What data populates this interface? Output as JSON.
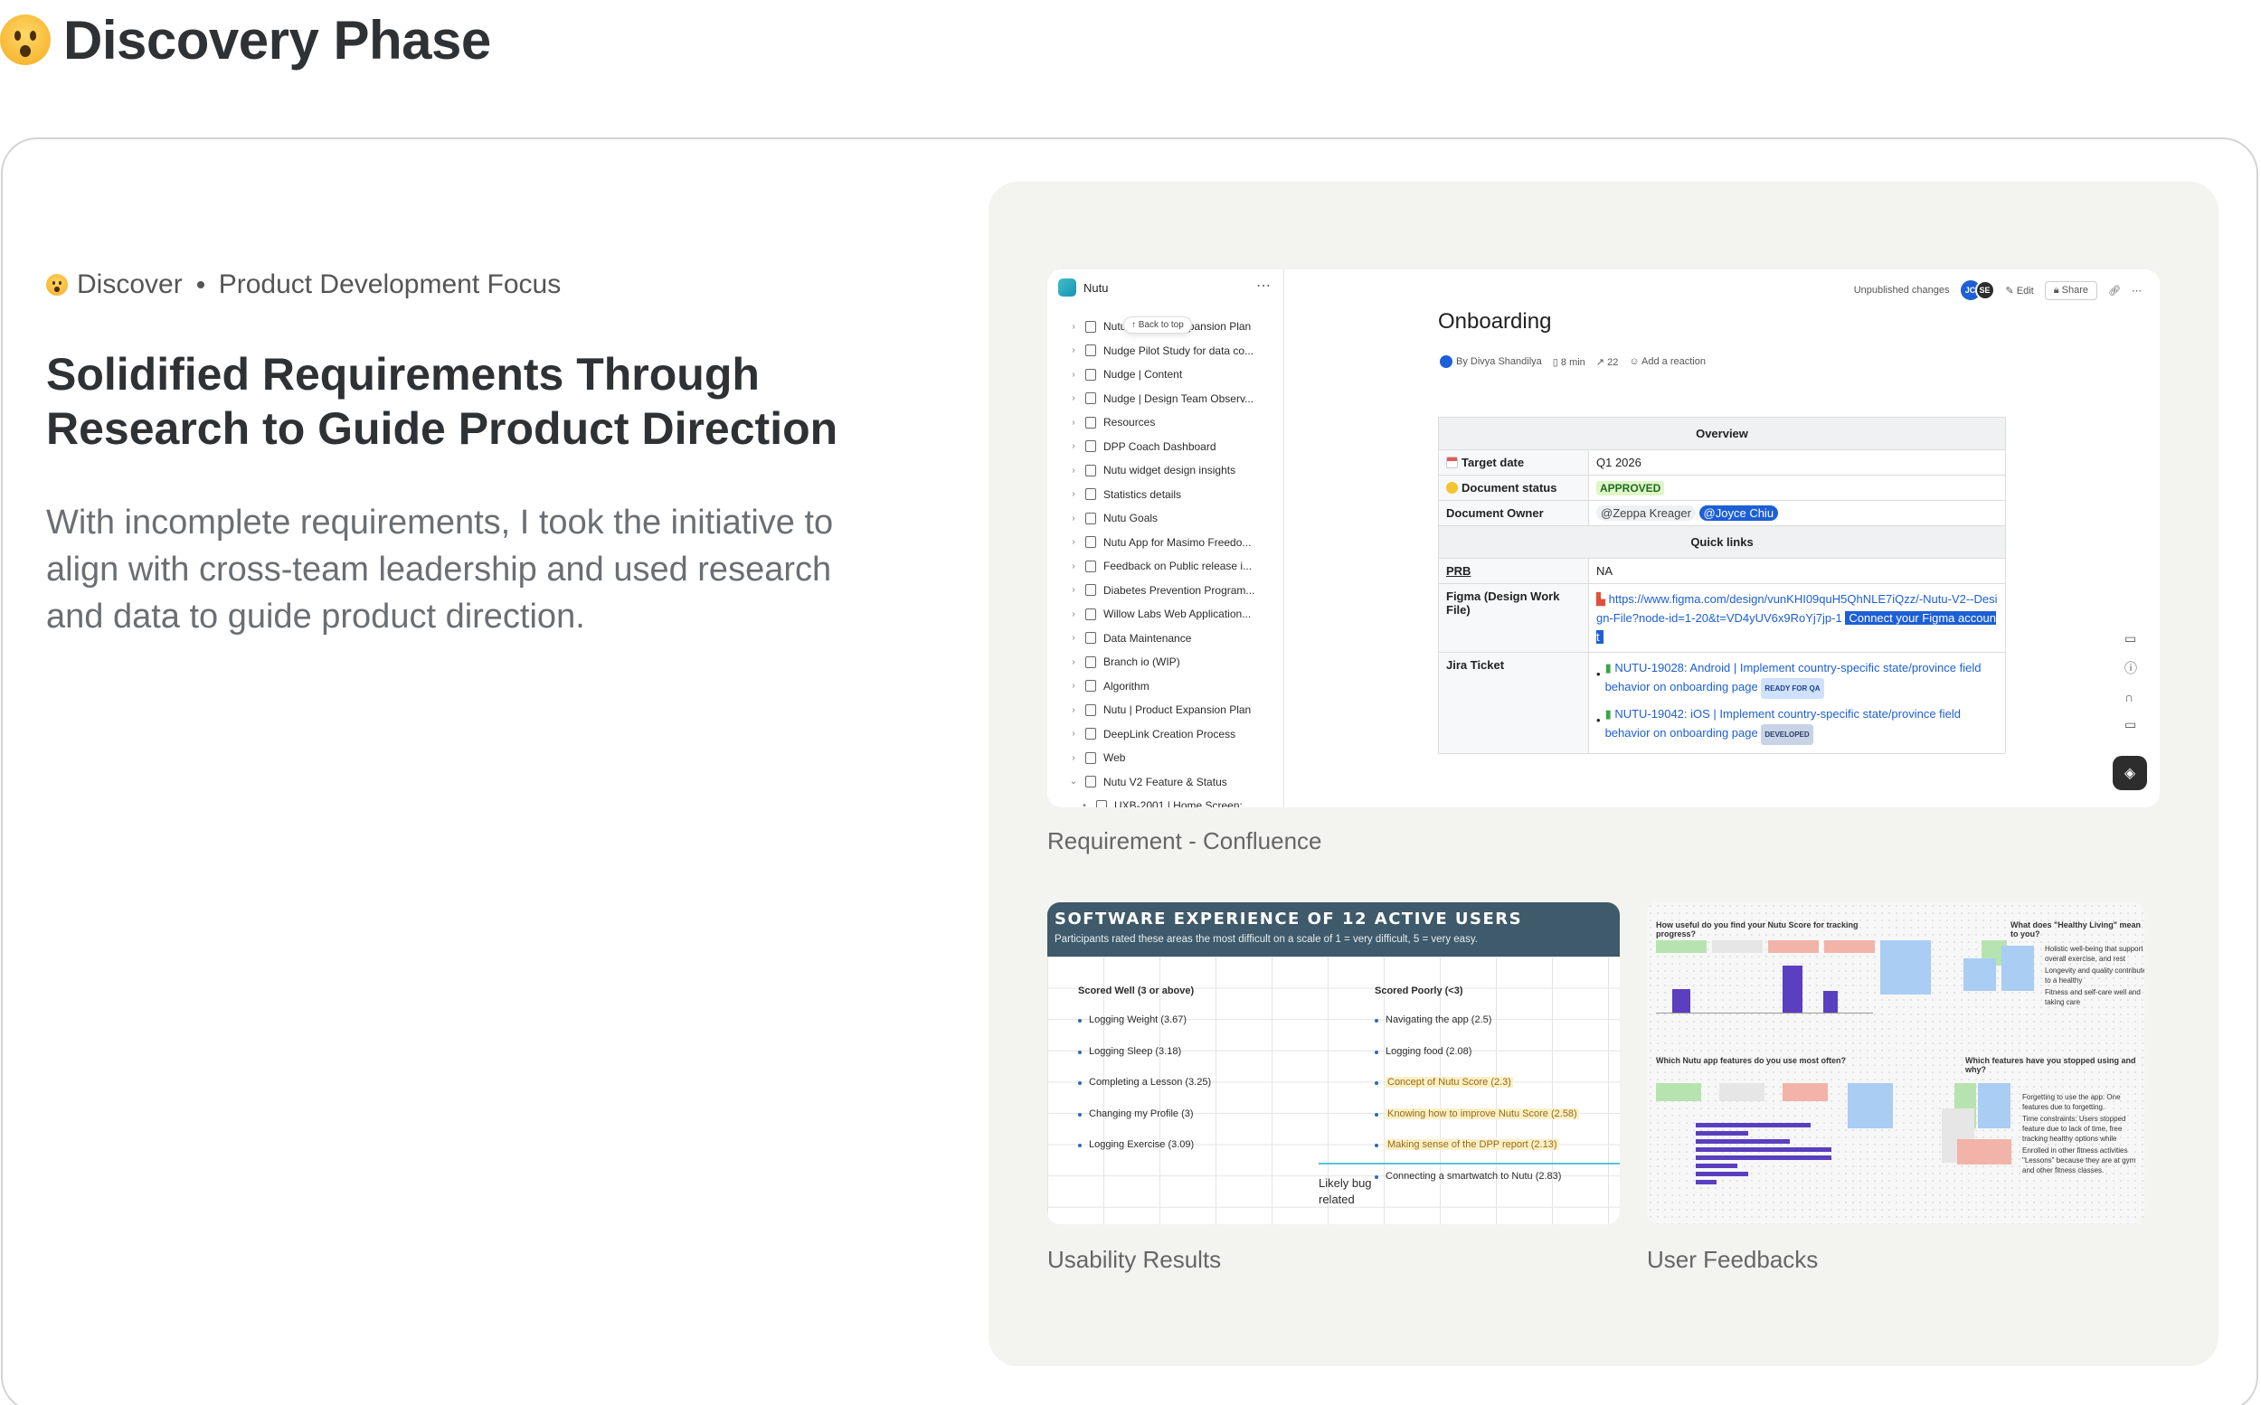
{
  "page": {
    "title": "Discovery Phase"
  },
  "breadcrumb": {
    "section": "Discover",
    "topic": "Product Development Focus"
  },
  "headline": "Solidified Requirements Through Research to Guide Product Direction",
  "body": "With incomplete requirements, I took the initiative to align with cross-team leadership and used research and data to guide product direction.",
  "captions": {
    "confluence": "Requirement - Confluence",
    "usability": "Usability Results",
    "feedback": "User Feedbacks"
  },
  "confluence": {
    "space_name": "Nutu",
    "back_to_top": "↑ Back to top",
    "tree": [
      "Nutu | Product Expansion Plan",
      "Nudge Pilot Study for data co...",
      "Nudge | Content",
      "Nudge | Design Team Observ...",
      "Resources",
      "DPP Coach Dashboard",
      "Nutu widget design insights",
      "Statistics details",
      "Nutu Goals",
      "Nutu App for Masimo Freedo...",
      "Feedback on Public release i...",
      "Diabetes Prevention Program...",
      "Willow Labs Web Application...",
      "Data Maintenance",
      "Branch io (WIP)",
      "Algorithm",
      "Nutu | Product Expansion Plan",
      "DeepLink Creation Process",
      "Web",
      "Nutu V2 Feature & Status",
      "UXB-2001 | Home Screen:"
    ],
    "topbar": {
      "status": "Unpublished changes",
      "avatar1": "JC",
      "avatar2": "SE",
      "edit": "Edit",
      "share": "Share"
    },
    "doc_title": "Onboarding",
    "byline": {
      "author": "By Divya Shandilya",
      "read_time": "8 min",
      "views": "22",
      "reaction": "Add a reaction"
    },
    "table": {
      "overview": "Overview",
      "target_date_label": "Target date",
      "target_date": "Q1 2026",
      "status_label": "Document status",
      "status": "APPROVED",
      "owner_label": "Document Owner",
      "owner1": "@Zeppa Kreager",
      "owner2": "@Joyce Chiu",
      "quick_links": "Quick links",
      "prb_label": "PRB",
      "prb": "NA",
      "figma_label": "Figma (Design Work File)",
      "figma_link": "https://www.figma.com/design/vunKHI09quH5QhNLE7iQzz/-Nutu-V2--Design-File?node-id=1-20&t=VD4yUV6x9RoYj7jp-1",
      "figma_connect": "Connect your Figma account",
      "jira_label": "Jira Ticket",
      "jira1": "NUTU-19028: Android | Implement country-specific state/province field behavior on onboarding page",
      "jira1_badge": "READY FOR QA",
      "jira2": "NUTU-19042: iOS | Implement country-specific state/province field behavior on onboarding page",
      "jira2_badge": "DEVELOPED"
    }
  },
  "usability": {
    "title": "SOFTWARE EXPERIENCE OF 12 ACTIVE USERS",
    "subtitle": "Participants rated these areas the most difficult on a scale of 1 = very difficult, 5 = very easy.",
    "well_header": "Scored Well (3 or above)",
    "well": [
      "Logging Weight (3.67)",
      "Logging Sleep (3.18)",
      "Completing a Lesson (3.25)",
      "Changing my Profile (3)",
      "Logging Exercise (3.09)"
    ],
    "poor_header": "Scored Poorly (<3)",
    "poor": [
      "Navigating the app (2.5)",
      "Logging food (2.08)",
      "Concept of Nutu Score (2.3)",
      "Knowing how to improve Nutu Score (2.58)",
      "Making sense of the DPP report (2.13)",
      "Connecting a smartwatch to Nutu (2.83)"
    ],
    "note": "Likely bug related"
  },
  "feedback": {
    "q1": "How useful do you find your Nutu Score for tracking progress?",
    "q2": "What does \"Healthy Living\" mean to you?",
    "q3": "Which Nutu app features do you use most often?",
    "q4": "Which features have you stopped using and why?",
    "q3_values": [
      0.11,
      0.05,
      0.09,
      0.13,
      0.13,
      0.04,
      0.05,
      0.02
    ],
    "healthy_bullets": [
      "Holistic well-being that support overall exercise, and rest",
      "Longevity and quality contribute to a healthy",
      "Fitness and self-care well and taking care"
    ],
    "stopped_bullets": [
      "Forgetting to use the app: One features due to forgetting.",
      "Time constraints: Users stopped feature due to lack of time, free tracking healthy options while",
      "Enrolled in other fitness activities \"Lessons\" because they are at gym and other fitness classes."
    ]
  }
}
